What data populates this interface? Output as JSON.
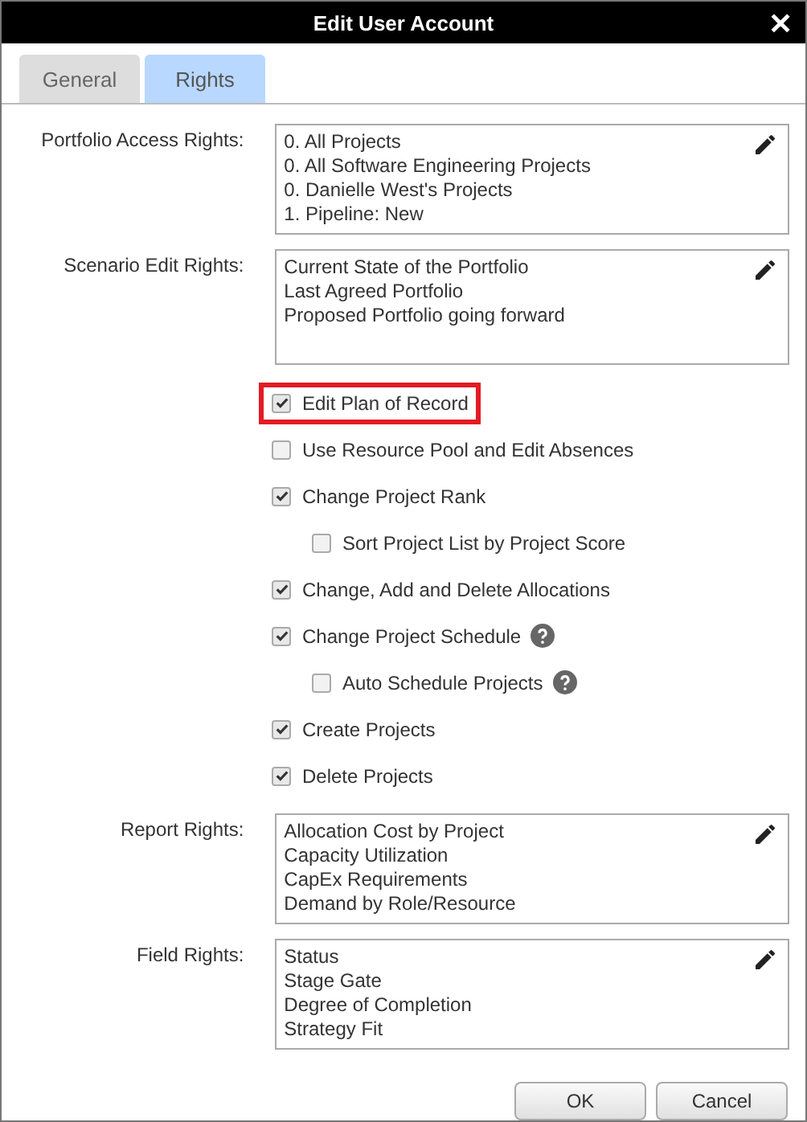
{
  "window": {
    "title": "Edit User Account",
    "close": "✕"
  },
  "tabs": [
    {
      "label": "General",
      "selected": false
    },
    {
      "label": "Rights",
      "selected": true
    }
  ],
  "lists_top": [
    {
      "label": "Portfolio Access Rights:",
      "items": [
        "0. All Projects",
        "0. All Software Engineering Projects",
        "0. Danielle West's Projects",
        "1. Pipeline: New"
      ]
    },
    {
      "label": "Scenario Edit Rights:",
      "items": [
        "Current State of the Portfolio",
        "Last Agreed Portfolio",
        "Proposed Portfolio going forward"
      ]
    }
  ],
  "options": [
    {
      "label": "Edit Plan of Record",
      "checked": true,
      "highlighted": true,
      "help": false
    },
    {
      "label": "Use Resource Pool and Edit Absences",
      "checked": false,
      "highlighted": false,
      "help": false
    },
    {
      "label": "Change Project Rank",
      "checked": true,
      "highlighted": false,
      "help": false,
      "children": [
        {
          "label": "Sort Project List by Project Score",
          "checked": false,
          "help": false
        }
      ]
    },
    {
      "label": "Change, Add and Delete Allocations",
      "checked": true,
      "highlighted": false,
      "help": false
    },
    {
      "label": "Change Project Schedule",
      "checked": true,
      "highlighted": false,
      "help": true,
      "children": [
        {
          "label": "Auto Schedule Projects",
          "checked": false,
          "help": true
        }
      ]
    },
    {
      "label": "Create Projects",
      "checked": true,
      "highlighted": false,
      "help": false
    },
    {
      "label": "Delete Projects",
      "checked": true,
      "highlighted": false,
      "help": false
    }
  ],
  "lists_bottom": [
    {
      "label": "Report Rights:",
      "items": [
        "Allocation Cost by Project",
        "Capacity Utilization",
        "CapEx Requirements",
        "Demand by Role/Resource"
      ]
    },
    {
      "label": "Field Rights:",
      "items": [
        "Status",
        "Stage Gate",
        "Degree of Completion",
        "Strategy Fit"
      ]
    }
  ],
  "buttons": [
    "OK",
    "Cancel"
  ]
}
